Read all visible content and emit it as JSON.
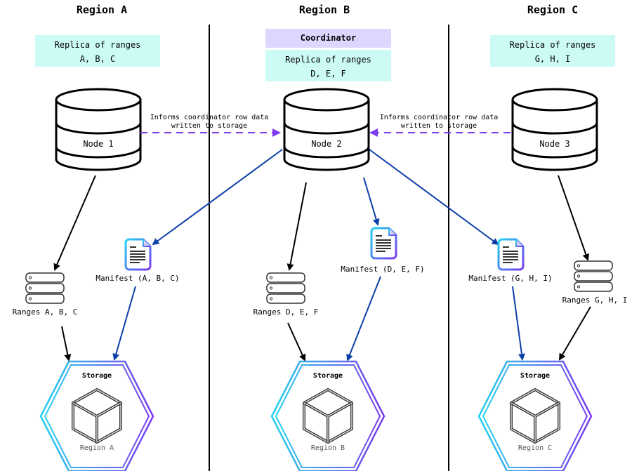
{
  "regions": [
    {
      "title": "Region A",
      "replica_line1": "Replica of ranges",
      "replica_line2": "A, B, C",
      "node": "Node 1",
      "ranges": "Ranges A, B, C",
      "manifest": "Manifest (A, B, C)",
      "storage_title": "Storage",
      "storage_region": "Region A"
    },
    {
      "title": "Region B",
      "coordinator": "Coordinator",
      "replica_line1": "Replica of ranges",
      "replica_line2": "D, E, F",
      "node": "Node 2",
      "ranges": "Ranges D, E, F",
      "manifest": "Manifest (D, E, F)",
      "storage_title": "Storage",
      "storage_region": "Region B"
    },
    {
      "title": "Region C",
      "replica_line1": "Replica of ranges",
      "replica_line2": "G, H, I",
      "node": "Node 3",
      "ranges": "Ranges G, H, I",
      "manifest": "Manifest (G, H, I)",
      "storage_title": "Storage",
      "storage_region": "Region C"
    }
  ],
  "arrows": {
    "inform_line1": "Informs coordinator row data",
    "inform_line2": "written to storage"
  },
  "colors": {
    "replica_bg": "#ccfbf6",
    "coordinator_bg": "#ddd6fe",
    "dashed_arrow": "#7c3aed",
    "manifest_arrow": "#0b3ea8",
    "gradient_start": "#22d3ee",
    "gradient_end": "#7c3aed"
  },
  "icons": [
    "database-icon",
    "server-stack-icon",
    "document-icon",
    "cube-icon",
    "hexagon-icon"
  ]
}
